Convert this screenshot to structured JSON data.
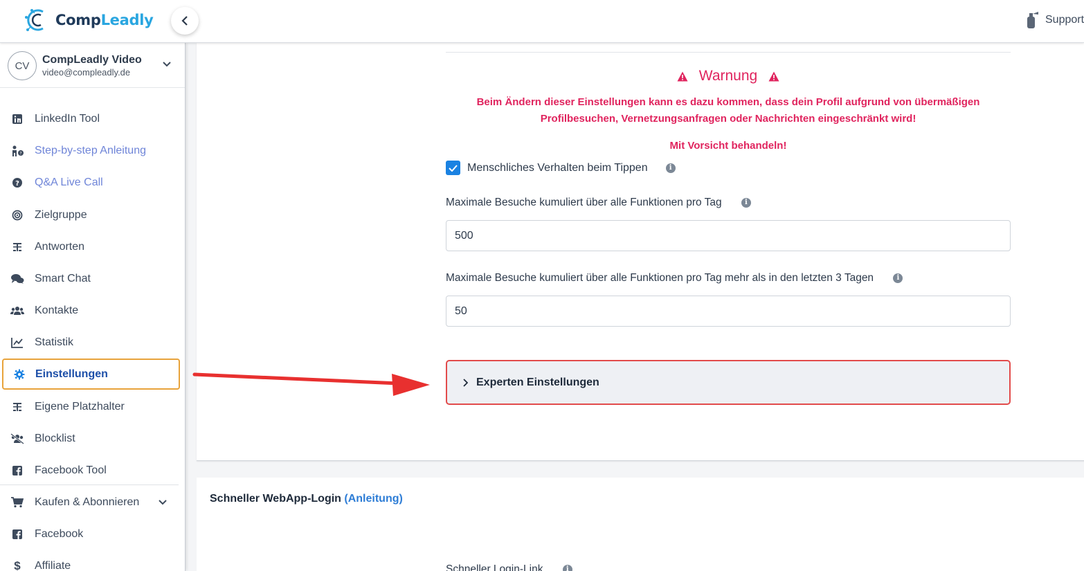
{
  "header": {
    "logo_text_main": "Comp",
    "logo_text_accent": "Leadly",
    "support_label": "Support"
  },
  "user": {
    "initials": "CV",
    "name": "CompLeadly Video",
    "email": "video@compleadly.de"
  },
  "sidebar": {
    "items": [
      {
        "label": "LinkedIn Tool",
        "icon": "linkedin-icon"
      },
      {
        "label": "Step-by-step Anleitung",
        "icon": "person-question-icon"
      },
      {
        "label": "Q&A Live Call",
        "icon": "question-circle-icon"
      },
      {
        "label": "Zielgruppe",
        "icon": "target-icon"
      },
      {
        "label": "Antworten",
        "icon": "reply-icon"
      },
      {
        "label": "Smart Chat",
        "icon": "chat-bubbles-icon"
      },
      {
        "label": "Kontakte",
        "icon": "users-icon"
      },
      {
        "label": "Statistik",
        "icon": "chart-line-icon"
      },
      {
        "label": "Einstellungen",
        "icon": "gear-icon"
      },
      {
        "label": "Eigene Platzhalter",
        "icon": "placeholder-icon"
      },
      {
        "label": "Blocklist",
        "icon": "users-slash-icon"
      },
      {
        "label": "Facebook Tool",
        "icon": "facebook-icon"
      },
      {
        "label": "Kaufen & Abonnieren",
        "icon": "cart-icon"
      },
      {
        "label": "Facebook",
        "icon": "facebook-icon"
      },
      {
        "label": "Affiliate",
        "icon": "dollar-icon"
      }
    ]
  },
  "warning": {
    "title": "Warnung",
    "text_line1": "Beim Ändern dieser Einstellungen kann es dazu kommen, dass dein Profil aufgrund von übermäßigen",
    "text_line2": "Profilbesuchen, Vernetzungsanfragen oder Nachrichten eingeschränkt wird!",
    "caution": "Mit Vorsicht behandeln!"
  },
  "settings": {
    "human_typing_label": "Menschliches Verhalten beim Tippen",
    "human_typing_checked": true,
    "max_visits_label": "Maximale Besuche kumuliert über alle Funktionen pro Tag",
    "max_visits_value": "500",
    "max_visits_more_label": "Maximale Besuche kumuliert über alle Funktionen pro Tag mehr als in den letzten 3 Tagen",
    "max_visits_more_value": "50",
    "expert_label": "Experten Einstellungen"
  },
  "login": {
    "title": "Schneller WebApp-Login",
    "link_text": "(Anleitung)",
    "link_label": "Schneller Login-Link"
  },
  "colors": {
    "warning": "#e0245e",
    "active_border": "#e8a33b",
    "expert_border": "#e24b4b",
    "checkbox": "#1a82e2"
  }
}
